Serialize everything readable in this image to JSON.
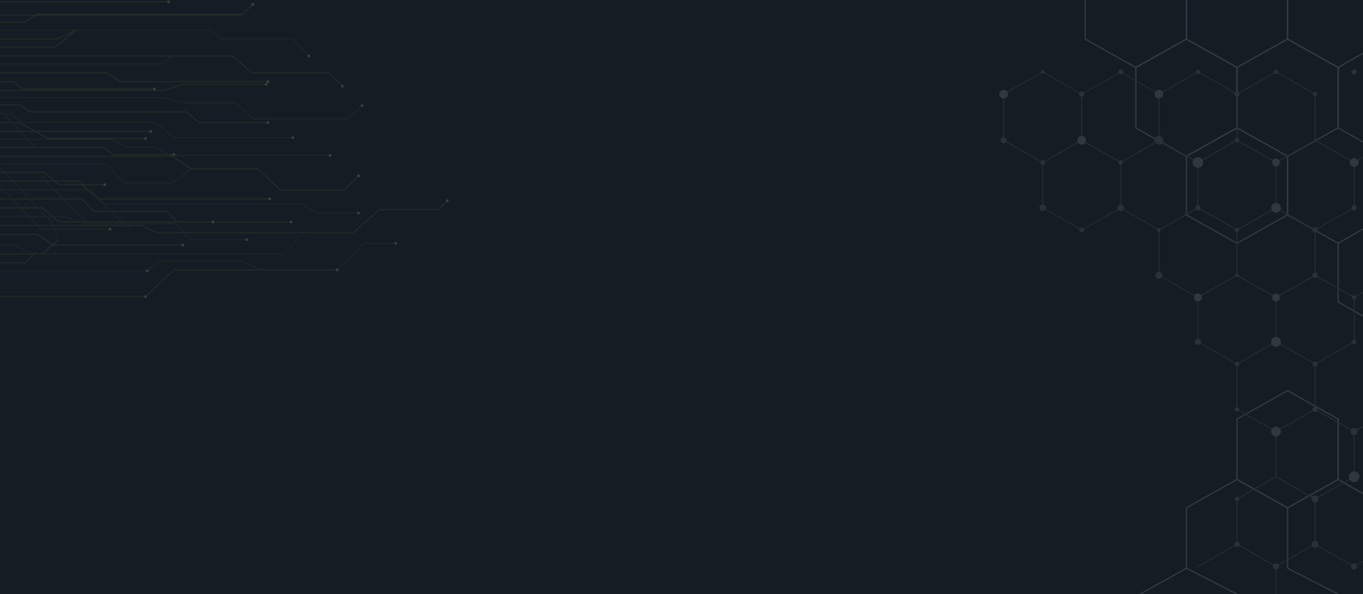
{
  "screen": {
    "background_color": "#151c24",
    "left_decoration": "circuit-lines-pattern",
    "right_decoration": "hexagon-network-pattern"
  }
}
